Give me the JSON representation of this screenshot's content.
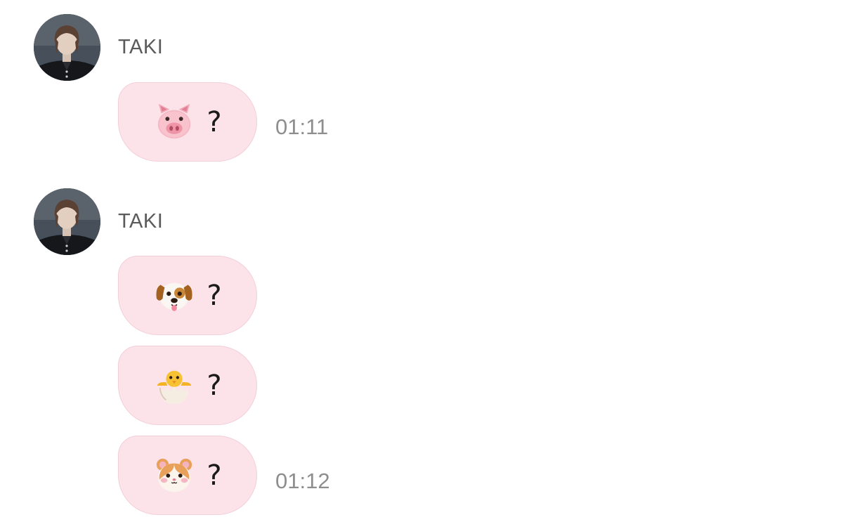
{
  "messages": [
    {
      "sender": "TAKI",
      "bubbles": [
        {
          "icon": "pig-face-emoji",
          "text": "?",
          "time": "01:11"
        }
      ]
    },
    {
      "sender": "TAKI",
      "bubbles": [
        {
          "icon": "dog-face-emoji",
          "text": "?",
          "time": ""
        },
        {
          "icon": "hatching-chick-emoji",
          "text": "?",
          "time": ""
        },
        {
          "icon": "hamster-face-emoji",
          "text": "?",
          "time": "01:12"
        }
      ]
    }
  ],
  "colors": {
    "bubble_bg": "#fce2e9",
    "bubble_border": "#f3cfd9",
    "name_text": "#5b5b5b",
    "time_text": "#8e8e8e"
  }
}
